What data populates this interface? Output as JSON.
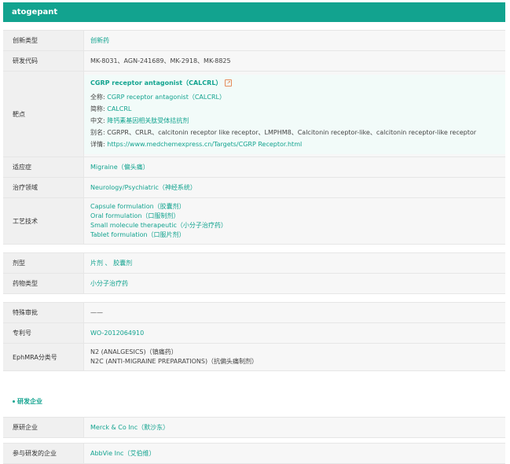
{
  "header": {
    "title": "atogepant"
  },
  "rows": {
    "innovation_type": {
      "label": "创新类型",
      "value": "创新药"
    },
    "dev_code": {
      "label": "研发代码",
      "value": "MK-8031、AGN-241689、MK-2918、MK-8825"
    },
    "target": {
      "label": "靶点",
      "heading": "CGRP receptor antagonist（CALCRL）",
      "full_name_key": "全称:",
      "full_name": "CGRP receptor antagonist（CALCRL）",
      "abbr_key": "简称:",
      "abbr": "CALCRL",
      "chinese_key": "中文:",
      "chinese": "降钙素基因相关肽受体拮抗剂",
      "alias_key": "别名:",
      "alias": "CGRPR、CRLR、calcitonin receptor like receptor、LMPHM8、Calcitonin receptor-like、calcitonin receptor-like receptor",
      "detail_key": "详情:",
      "detail": "https://www.medchemexpress.cn/Targets/CGRP Receptor.html"
    },
    "indication": {
      "label": "适应症",
      "value": "Migraine（偏头痛）"
    },
    "therapy_area": {
      "label": "治疗领域",
      "value": "Neurology/Psychiatric（神经系统）"
    },
    "technology": {
      "label": "工艺技术",
      "items": [
        "Capsule formulation（胶囊剂）",
        "Oral formulation（口服制剂）",
        "Small molecule therapeutic（小分子治疗药）",
        "Tablet formulation（口服片剂）"
      ]
    },
    "dosage_form": {
      "label": "剂型",
      "value": "片剂 、 胶囊剂"
    },
    "drug_type": {
      "label": "药物类型",
      "value": "小分子治疗药"
    },
    "special_review": {
      "label": "特殊审批",
      "value": "——"
    },
    "patent": {
      "label": "专利号",
      "value": "WO-2012064910"
    },
    "ephmra": {
      "label": "EphMRA分类号",
      "line1": "N2 (ANALGESICS)（镇痛药）",
      "line2": "N2C (ANTI-MIGRAINE PREPARATIONS)（抗偏头痛制剂）"
    }
  },
  "company_section": {
    "title": "研发企业",
    "originator": {
      "label": "原研企业",
      "value": "Merck & Co Inc（默沙东）"
    },
    "participants": {
      "label": "参与研发的企业",
      "value": "AbbVie Inc（艾伯维）"
    }
  },
  "colors": {
    "accent": "#12a38f",
    "label_bg": "#f0f0f0",
    "row_bg": "#f7f7f7"
  },
  "icons": {
    "external": "external-link-icon"
  }
}
